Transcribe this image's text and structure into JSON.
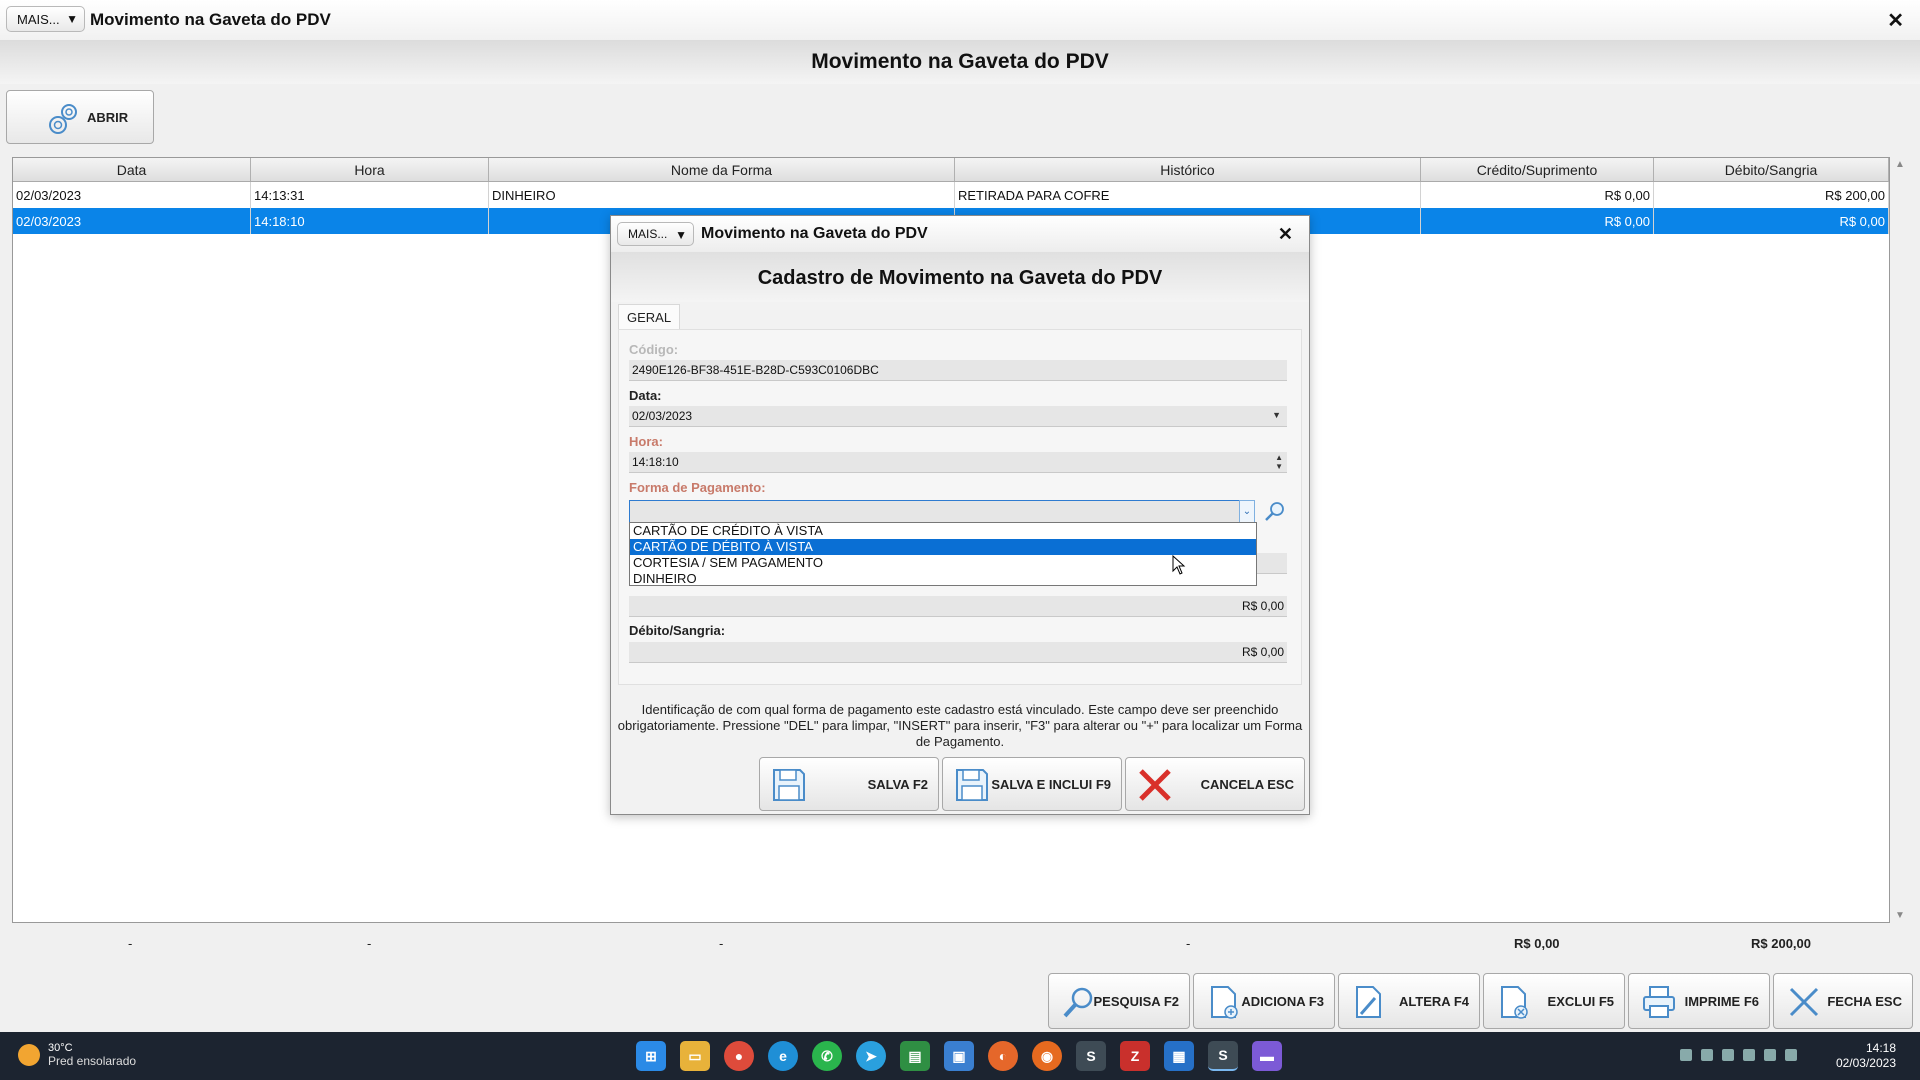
{
  "window": {
    "mais_label": "MAIS...",
    "title": "Movimento na Gaveta do PDV",
    "close": "✕",
    "header": "Movimento na Gaveta do PDV",
    "abrir_label": "ABRIR"
  },
  "grid": {
    "columns": [
      "Data",
      "Hora",
      "Nome da Forma",
      "Histórico",
      "Crédito/Suprimento",
      "Débito/Sangria"
    ],
    "rows": [
      {
        "data": "02/03/2023",
        "hora": "14:13:31",
        "forma": "DINHEIRO",
        "historico": "RETIRADA PARA COFRE",
        "credito": "R$ 0,00",
        "debito": "R$ 200,00"
      },
      {
        "data": "02/03/2023",
        "hora": "14:18:10",
        "forma": "",
        "historico": "",
        "credito": "R$ 0,00",
        "debito": "R$ 0,00"
      }
    ],
    "selected_row": 1
  },
  "totals": {
    "c1": "-",
    "c2": "-",
    "c3": "-",
    "c4": "-",
    "credito": "R$ 0,00",
    "debito": "R$ 200,00"
  },
  "toolbar": {
    "pesquisa": "PESQUISA F2",
    "adiciona": "ADICIONA F3",
    "altera": "ALTERA F4",
    "exclui": "EXCLUI F5",
    "imprime": "IMPRIME F6",
    "fecha": "FECHA ESC"
  },
  "dialog": {
    "mais_label": "MAIS...",
    "title": "Movimento na Gaveta do PDV",
    "close": "✕",
    "header": "Cadastro de Movimento na Gaveta do PDV",
    "tab": "GERAL",
    "codigo_label": "Código:",
    "codigo_value": "2490E126-BF38-451E-B28D-C593C0106DBC",
    "data_label": "Data:",
    "data_value": "02/03/2023",
    "hora_label": "Hora:",
    "hora_value": "14:18:10",
    "forma_label": "Forma de Pagamento:",
    "forma_value": "",
    "forma_options": [
      "CARTÃO DE CRÉDITO À VISTA",
      "CARTÃO DE DÉBITO À VISTA",
      "CORTESIA / SEM PAGAMENTO",
      "DINHEIRO"
    ],
    "forma_highlighted": 1,
    "credito_value": "R$ 0,00",
    "debito_label": "Débito/Sangria:",
    "debito_value": "R$ 0,00",
    "hint": "Identificação de com qual forma de pagamento este cadastro está vinculado. Este campo deve ser preenchido obrigatoriamente. Pressione \"DEL\" para limpar, \"INSERT\" para inserir, \"F3\" para alterar ou \"+\" para localizar um Forma de Pagamento.",
    "salva": "SALVA F2",
    "salva_inclui": "SALVA E INCLUI F9",
    "cancela": "CANCELA ESC"
  },
  "taskbar": {
    "temp": "30°C",
    "weather": "Pred ensolarado",
    "time": "14:18",
    "date": "02/03/2023"
  },
  "colors": {
    "selection": "#0a84e8",
    "required_label": "#c87a6a",
    "cancel_icon": "#d9302a",
    "taskbar": "#1c2430"
  }
}
